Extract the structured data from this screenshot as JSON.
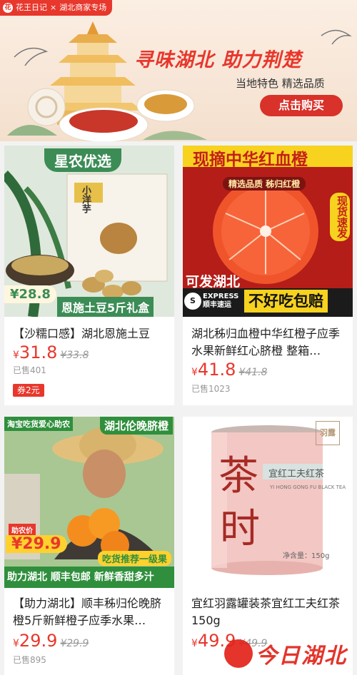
{
  "banner": {
    "brand": "花王日记",
    "brand_sep": "×",
    "tag": "湖北商家专场",
    "title": "寻味湖北 助力荆楚",
    "subtitle": "当地特色 精选品质",
    "buy_button": "点击购买"
  },
  "products": [
    {
      "title": "【沙糯口感】湖北恩施土豆",
      "price_symbol": "¥",
      "price": "31.8",
      "old_price": "¥33.8",
      "sold": "已售401",
      "coupon": "券2元",
      "img": {
        "top_label": "星农优选",
        "box_text": "小洋芋",
        "price_tag": "¥28.8",
        "bottom_label": "恩施土豆5斤礼盒"
      }
    },
    {
      "title": "湖北秭归血橙中华红橙子应季水果新鲜红心脐橙 整箱…",
      "price_symbol": "¥",
      "price": "41.8",
      "old_price": "¥41.8",
      "sold": "已售1023",
      "img": {
        "top_label": "现摘中华红血橙",
        "sub_label": "精选品质 秭归红橙",
        "side_label": "现货速发",
        "ship_label": "可发湖北",
        "express": "EXPRESS",
        "express_cn": "顺丰速运",
        "guarantee": "不好吃包赔"
      }
    },
    {
      "title": "【助力湖北】顺丰秭归伦晚脐橙5斤新鲜橙子应季水果…",
      "price_symbol": "¥",
      "price": "29.9",
      "old_price": "¥29.9",
      "sold": "已售895",
      "img": {
        "top_left": "淘宝吃货爱心助农",
        "top_right": "湖北伦晚脐橙",
        "aid_label": "助农价",
        "price_tag": "¥29.9",
        "recommend": "吃货推荐一级果",
        "bottom_label": "助力湖北 顺丰包邮 新鲜香甜多汁"
      }
    },
    {
      "title": "宜红羽露罐装茶宜红工夫红茶150g",
      "price_symbol": "¥",
      "price": "49.9",
      "old_price": "¥49.9",
      "img": {
        "can_big": "茶",
        "can_big2": "时",
        "can_label": "宜红工夫红茶",
        "can_en": "YI HONG GONG FU BLACK TEA",
        "can_weight": "净含量：150g",
        "seal": "羽露"
      }
    }
  ],
  "watermark": "今日湖北",
  "colors": {
    "accent": "#e8372c",
    "banner_bg": "#fbeee2"
  }
}
